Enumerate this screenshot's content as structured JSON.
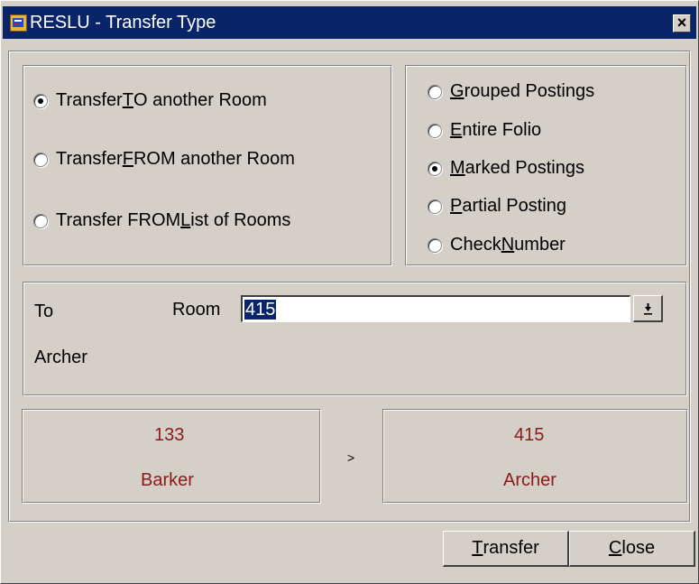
{
  "window": {
    "title": "RESLU - Transfer Type",
    "close_glyph": "×"
  },
  "transfer_direction": {
    "options": [
      {
        "pre": "Transfer ",
        "key": "T",
        "post": "O another Room",
        "checked": true
      },
      {
        "pre": "Transfer ",
        "key": "F",
        "post": "ROM another Room",
        "checked": false
      },
      {
        "pre": "Transfer FROM ",
        "key": "L",
        "post": "ist of Rooms",
        "checked": false
      }
    ]
  },
  "posting_type": {
    "options": [
      {
        "pre": "",
        "key": "G",
        "post": "rouped Postings",
        "checked": false
      },
      {
        "pre": "",
        "key": "E",
        "post": "ntire Folio",
        "checked": false
      },
      {
        "pre": "",
        "key": "M",
        "post": "arked Postings",
        "checked": true
      },
      {
        "pre": "",
        "key": "P",
        "post": "artial Posting",
        "checked": false
      },
      {
        "pre": "Check ",
        "key": "N",
        "post": "umber",
        "checked": false
      }
    ]
  },
  "target": {
    "to_label": "To",
    "room_label": "Room",
    "room_value": "415",
    "guest_name": "Archer"
  },
  "summary": {
    "from_room": "133",
    "from_name": "Barker",
    "arrow": ">",
    "to_room": "415",
    "to_name": "Archer"
  },
  "buttons": {
    "transfer": {
      "key": "T",
      "post": "ransfer"
    },
    "close": {
      "key": "C",
      "post": "lose"
    }
  },
  "colors": {
    "titlebar": "#0a246a",
    "face": "#d4d0c8",
    "summary_text": "#8b1a1a",
    "selection": "#0a246a"
  }
}
